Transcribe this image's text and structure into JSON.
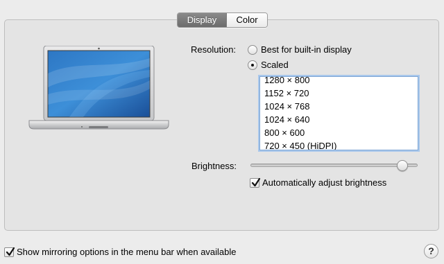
{
  "tabs": [
    {
      "label": "Display",
      "selected": true
    },
    {
      "label": "Color",
      "selected": false
    }
  ],
  "resolution": {
    "label": "Resolution:",
    "options": [
      {
        "label": "Best for built-in display",
        "selected": false
      },
      {
        "label": "Scaled",
        "selected": true
      }
    ],
    "list": [
      "1280 × 800",
      "1152 × 720",
      "1024 × 768",
      "1024 × 640",
      "800 × 600",
      "720 × 450 (HiDPI)"
    ]
  },
  "brightness": {
    "label": "Brightness:",
    "value": 0.91,
    "auto_label": "Automatically adjust brightness",
    "auto_checked": true
  },
  "footer": {
    "mirroring_label": "Show mirroring options in the menu bar when available",
    "mirroring_checked": true,
    "help_label": "?"
  },
  "colors": {
    "selected_tab": "#737373",
    "focus_ring": "#7ea6d4"
  },
  "icons": {
    "laptop": "laptop-icon",
    "check": "checkmark-icon",
    "help": "help-icon"
  }
}
